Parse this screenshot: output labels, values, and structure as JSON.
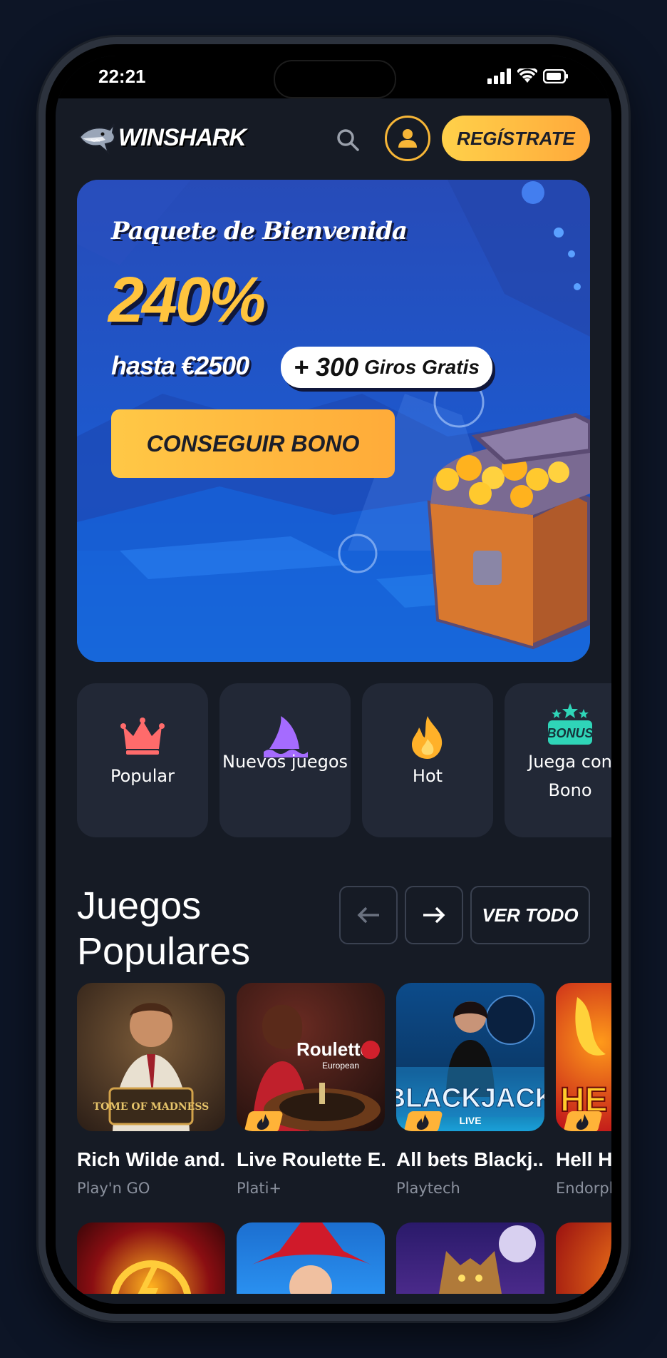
{
  "status_bar": {
    "time": "22:21"
  },
  "header": {
    "brand": "WINSHARK",
    "register_label": "REGÍSTRATE"
  },
  "banner": {
    "title": "Paquete de Bienvenida",
    "percent": "240%",
    "up_to": "hasta €2500",
    "spins_number": "+ 300",
    "spins_text": "Giros Gratis",
    "cta_label": "CONSEGUIR BONO"
  },
  "categories": [
    {
      "label": "Popular",
      "icon": "crown-icon"
    },
    {
      "label": "Nuevos juegos",
      "icon": "shark-fin-icon"
    },
    {
      "label": "Hot",
      "icon": "fire-icon"
    },
    {
      "label": "Juega con Bono",
      "icon": "bonus-icon",
      "icon_text": "BONUS"
    }
  ],
  "popular": {
    "title": "Juegos Populares",
    "see_all_label": "VER TODO",
    "games": [
      {
        "title": "Rich Wilde and...",
        "provider": "Play'n GO",
        "thumb_text": "TOME OF MADNESS",
        "hot": false
      },
      {
        "title": "Live Roulette E...",
        "provider": "Plati+",
        "thumb_text": "Roulette",
        "thumb_subtext": "European",
        "hot": true
      },
      {
        "title": "All bets Blackj...",
        "provider": "Playtech",
        "thumb_text": "BLACKJACK",
        "thumb_subtext": "LIVE",
        "hot": true
      },
      {
        "title": "Hell Hot",
        "provider": "Endorphina",
        "thumb_text": "HE",
        "hot": true
      }
    ]
  },
  "colors": {
    "accent": "#ffb338",
    "background": "#161b25",
    "card": "#222836"
  }
}
